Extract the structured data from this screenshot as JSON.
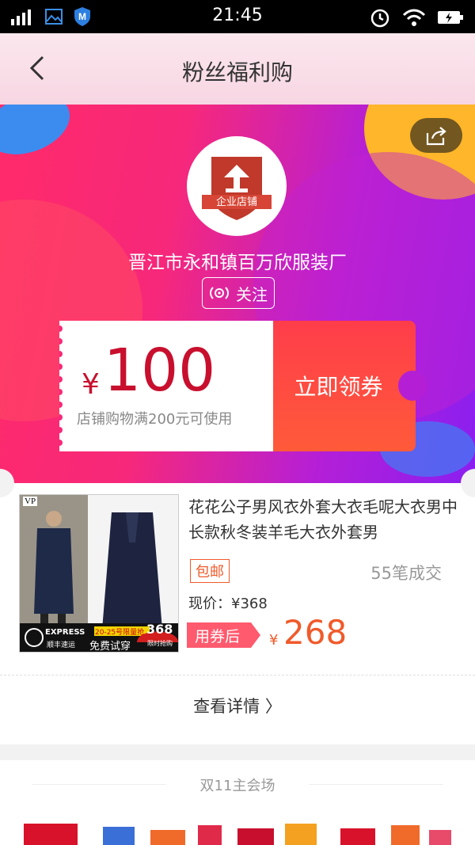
{
  "status_bar": {
    "time": "21:45"
  },
  "nav": {
    "title": "粉丝福利购"
  },
  "shop": {
    "logo_text": "企业店铺",
    "name": "晋江市永和镇百万欣服装厂",
    "follow_label": "关注"
  },
  "coupon": {
    "currency": "¥",
    "amount": "100",
    "condition": "店铺购物满200元可使用",
    "claim_label": "立即领券"
  },
  "product": {
    "title": "花花公子男风衣外套大衣毛呢大衣男中长款秋冬装羊毛大衣外套男",
    "image_texts": {
      "brand": "VP",
      "express": "EXPRESS",
      "express_cn": "顺丰速运",
      "promo": "20-25号限量抢",
      "try": "免费试穿",
      "badge_price": "368",
      "badge_sub": "限时抢购"
    },
    "free_shipping": "包邮",
    "sold": "55笔成交",
    "current_price": "现价：¥368",
    "after_coupon_label": "用券后",
    "final_currency": "¥",
    "final_price": "268",
    "detail_link": "查看详情 〉"
  },
  "section2": {
    "header": "双11主会场"
  },
  "colors": {
    "accent": "#f05a2a",
    "coupon_red": "#c8102e",
    "brand_pink": "#ff2a6a",
    "brand_purple": "#8a1ff0"
  }
}
